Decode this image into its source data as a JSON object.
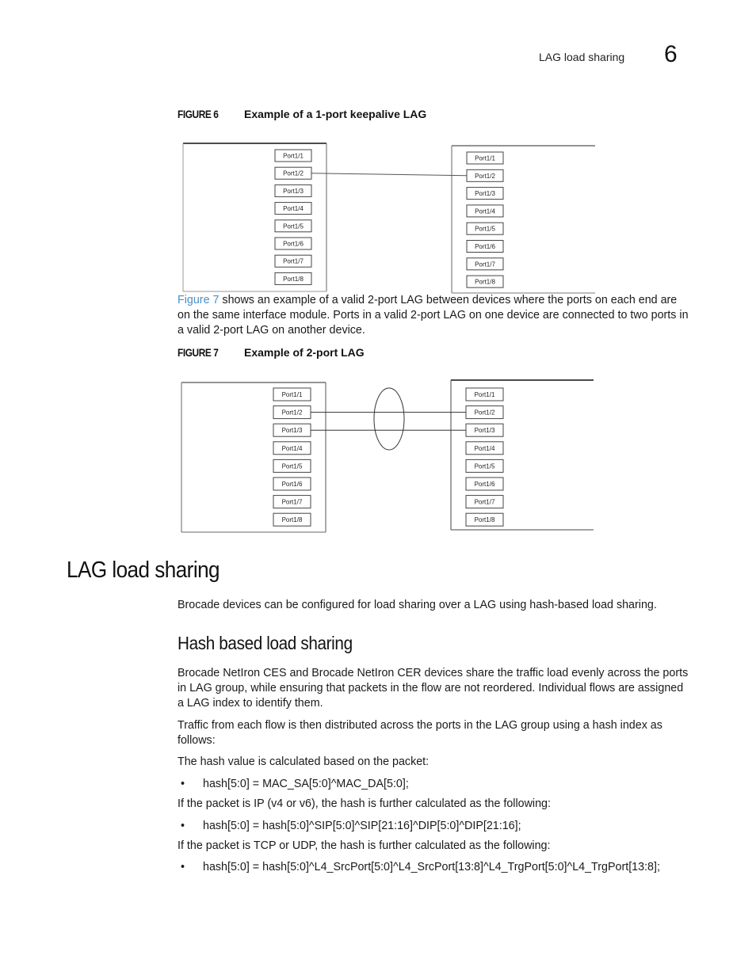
{
  "header": {
    "running_title": "LAG load sharing",
    "chapter_number": "6"
  },
  "figure6": {
    "number": "FIGURE 6",
    "title": "Example of a 1-port keepalive LAG",
    "left_device_ports": [
      "Port1/1",
      "Port1/2",
      "Port1/3",
      "Port1/4",
      "Port1/5",
      "Port1/6",
      "Port1/7",
      "Port1/8"
    ],
    "right_device_ports": [
      "Port1/1",
      "Port1/2",
      "Port1/3",
      "Port1/4",
      "Port1/5",
      "Port1/6",
      "Port1/7",
      "Port1/8"
    ],
    "connections": [
      {
        "from": "Port1/2",
        "to": "Port1/2"
      }
    ]
  },
  "para_fig7": {
    "link_text": "Figure 7",
    "text": " shows an example of a valid 2-port LAG between devices where the ports on each end are on the same interface module. Ports in a valid 2-port LAG on one device are connected to two ports in a valid 2-port LAG on another device."
  },
  "figure7": {
    "number": "FIGURE 7",
    "title": "Example of 2-port LAG",
    "left_device_ports": [
      "Port1/1",
      "Port1/2",
      "Port1/3",
      "Port1/4",
      "Port1/5",
      "Port1/6",
      "Port1/7",
      "Port1/8"
    ],
    "right_device_ports": [
      "Port1/1",
      "Port1/2",
      "Port1/3",
      "Port1/4",
      "Port1/5",
      "Port1/6",
      "Port1/7",
      "Port1/8"
    ],
    "connections": [
      {
        "from": "Port1/2",
        "to": "Port1/2"
      },
      {
        "from": "Port1/3",
        "to": "Port1/3"
      }
    ],
    "lag_grouping": "ellipse"
  },
  "section": {
    "title": "LAG load sharing",
    "intro": "Brocade devices can be configured for load sharing over a LAG using hash-based load sharing."
  },
  "subsection": {
    "title": "Hash based load sharing",
    "p1": "Brocade NetIron CES and Brocade NetIron CER devices share the traffic load evenly across the ports in LAG group, while ensuring that packets in the flow are not reordered. Individual flows are assigned a LAG index to identify them.",
    "p2": "Traffic from each flow is then distributed across the ports in the LAG group using a hash index as follows:",
    "p3": "The hash value is calculated based on the packet:",
    "bullet1": "hash[5:0] = MAC_SA[5:0]^MAC_DA[5:0];",
    "p4": "If the packet is IP (v4 or v6), the hash is further calculated as the following:",
    "bullet2": "hash[5:0] = hash[5:0]^SIP[5:0]^SIP[21:16]^DIP[5:0]^DIP[21:16];",
    "p5": "If the packet is TCP or UDP, the hash is further calculated as the following:",
    "bullet3": "hash[5:0] = hash[5:0]^L4_SrcPort[5:0]^L4_SrcPort[13:8]^L4_TrgPort[5:0]^L4_TrgPort[13:8];",
    "bullet_glyph": "•"
  }
}
